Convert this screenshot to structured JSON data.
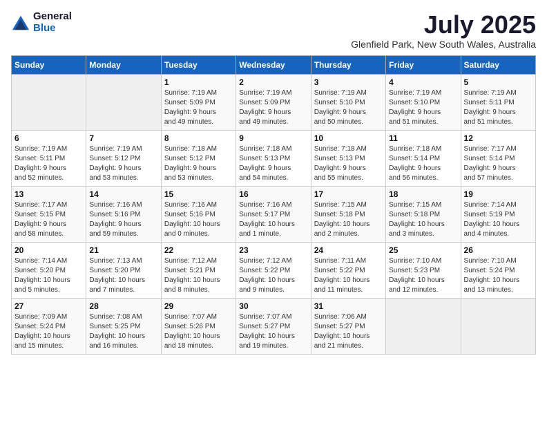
{
  "logo": {
    "general": "General",
    "blue": "Blue"
  },
  "title": "July 2025",
  "subtitle": "Glenfield Park, New South Wales, Australia",
  "days_header": [
    "Sunday",
    "Monday",
    "Tuesday",
    "Wednesday",
    "Thursday",
    "Friday",
    "Saturday"
  ],
  "weeks": [
    [
      {
        "num": "",
        "info": ""
      },
      {
        "num": "",
        "info": ""
      },
      {
        "num": "1",
        "info": "Sunrise: 7:19 AM\nSunset: 5:09 PM\nDaylight: 9 hours\nand 49 minutes."
      },
      {
        "num": "2",
        "info": "Sunrise: 7:19 AM\nSunset: 5:09 PM\nDaylight: 9 hours\nand 49 minutes."
      },
      {
        "num": "3",
        "info": "Sunrise: 7:19 AM\nSunset: 5:10 PM\nDaylight: 9 hours\nand 50 minutes."
      },
      {
        "num": "4",
        "info": "Sunrise: 7:19 AM\nSunset: 5:10 PM\nDaylight: 9 hours\nand 51 minutes."
      },
      {
        "num": "5",
        "info": "Sunrise: 7:19 AM\nSunset: 5:11 PM\nDaylight: 9 hours\nand 51 minutes."
      }
    ],
    [
      {
        "num": "6",
        "info": "Sunrise: 7:19 AM\nSunset: 5:11 PM\nDaylight: 9 hours\nand 52 minutes."
      },
      {
        "num": "7",
        "info": "Sunrise: 7:19 AM\nSunset: 5:12 PM\nDaylight: 9 hours\nand 53 minutes."
      },
      {
        "num": "8",
        "info": "Sunrise: 7:18 AM\nSunset: 5:12 PM\nDaylight: 9 hours\nand 53 minutes."
      },
      {
        "num": "9",
        "info": "Sunrise: 7:18 AM\nSunset: 5:13 PM\nDaylight: 9 hours\nand 54 minutes."
      },
      {
        "num": "10",
        "info": "Sunrise: 7:18 AM\nSunset: 5:13 PM\nDaylight: 9 hours\nand 55 minutes."
      },
      {
        "num": "11",
        "info": "Sunrise: 7:18 AM\nSunset: 5:14 PM\nDaylight: 9 hours\nand 56 minutes."
      },
      {
        "num": "12",
        "info": "Sunrise: 7:17 AM\nSunset: 5:14 PM\nDaylight: 9 hours\nand 57 minutes."
      }
    ],
    [
      {
        "num": "13",
        "info": "Sunrise: 7:17 AM\nSunset: 5:15 PM\nDaylight: 9 hours\nand 58 minutes."
      },
      {
        "num": "14",
        "info": "Sunrise: 7:16 AM\nSunset: 5:16 PM\nDaylight: 9 hours\nand 59 minutes."
      },
      {
        "num": "15",
        "info": "Sunrise: 7:16 AM\nSunset: 5:16 PM\nDaylight: 10 hours\nand 0 minutes."
      },
      {
        "num": "16",
        "info": "Sunrise: 7:16 AM\nSunset: 5:17 PM\nDaylight: 10 hours\nand 1 minute."
      },
      {
        "num": "17",
        "info": "Sunrise: 7:15 AM\nSunset: 5:18 PM\nDaylight: 10 hours\nand 2 minutes."
      },
      {
        "num": "18",
        "info": "Sunrise: 7:15 AM\nSunset: 5:18 PM\nDaylight: 10 hours\nand 3 minutes."
      },
      {
        "num": "19",
        "info": "Sunrise: 7:14 AM\nSunset: 5:19 PM\nDaylight: 10 hours\nand 4 minutes."
      }
    ],
    [
      {
        "num": "20",
        "info": "Sunrise: 7:14 AM\nSunset: 5:20 PM\nDaylight: 10 hours\nand 5 minutes."
      },
      {
        "num": "21",
        "info": "Sunrise: 7:13 AM\nSunset: 5:20 PM\nDaylight: 10 hours\nand 7 minutes."
      },
      {
        "num": "22",
        "info": "Sunrise: 7:12 AM\nSunset: 5:21 PM\nDaylight: 10 hours\nand 8 minutes."
      },
      {
        "num": "23",
        "info": "Sunrise: 7:12 AM\nSunset: 5:22 PM\nDaylight: 10 hours\nand 9 minutes."
      },
      {
        "num": "24",
        "info": "Sunrise: 7:11 AM\nSunset: 5:22 PM\nDaylight: 10 hours\nand 11 minutes."
      },
      {
        "num": "25",
        "info": "Sunrise: 7:10 AM\nSunset: 5:23 PM\nDaylight: 10 hours\nand 12 minutes."
      },
      {
        "num": "26",
        "info": "Sunrise: 7:10 AM\nSunset: 5:24 PM\nDaylight: 10 hours\nand 13 minutes."
      }
    ],
    [
      {
        "num": "27",
        "info": "Sunrise: 7:09 AM\nSunset: 5:24 PM\nDaylight: 10 hours\nand 15 minutes."
      },
      {
        "num": "28",
        "info": "Sunrise: 7:08 AM\nSunset: 5:25 PM\nDaylight: 10 hours\nand 16 minutes."
      },
      {
        "num": "29",
        "info": "Sunrise: 7:07 AM\nSunset: 5:26 PM\nDaylight: 10 hours\nand 18 minutes."
      },
      {
        "num": "30",
        "info": "Sunrise: 7:07 AM\nSunset: 5:27 PM\nDaylight: 10 hours\nand 19 minutes."
      },
      {
        "num": "31",
        "info": "Sunrise: 7:06 AM\nSunset: 5:27 PM\nDaylight: 10 hours\nand 21 minutes."
      },
      {
        "num": "",
        "info": ""
      },
      {
        "num": "",
        "info": ""
      }
    ]
  ]
}
